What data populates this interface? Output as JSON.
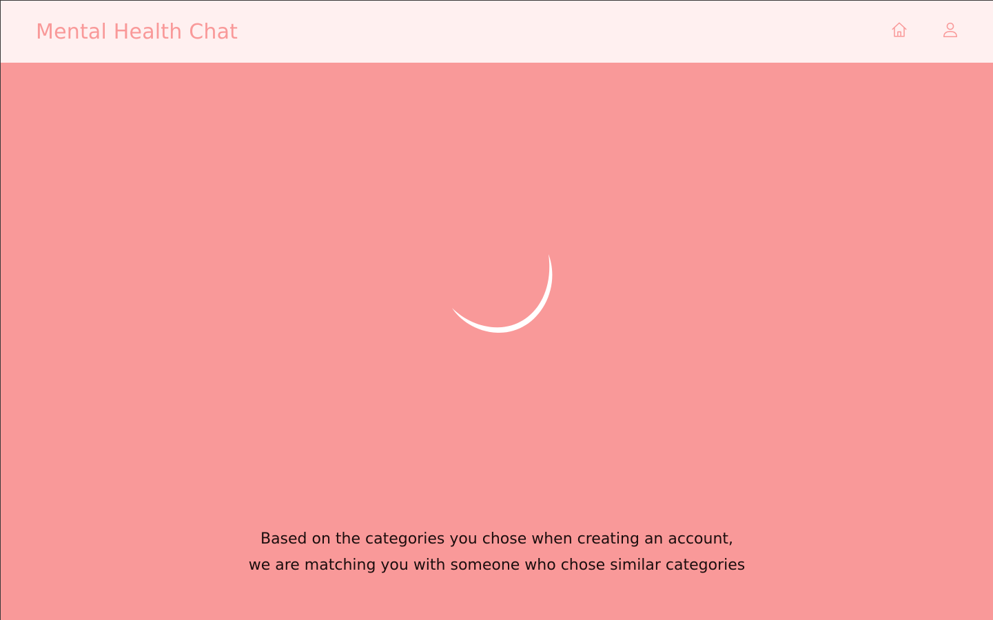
{
  "header": {
    "brand": "Mental Health Chat",
    "nav": {
      "home_icon": "home-icon",
      "profile_icon": "user-icon"
    }
  },
  "main": {
    "loading_icon": "loading-spinner",
    "message": {
      "line1": "Based on the categories you chose when creating an account,",
      "line2": "we are matching you with someone who chose similar categories"
    }
  },
  "colors": {
    "background": "#f99999",
    "header_background": "#fff0f0",
    "brand": "#f99999",
    "spinner": "#ffffff",
    "text": "#1a0d0d"
  }
}
